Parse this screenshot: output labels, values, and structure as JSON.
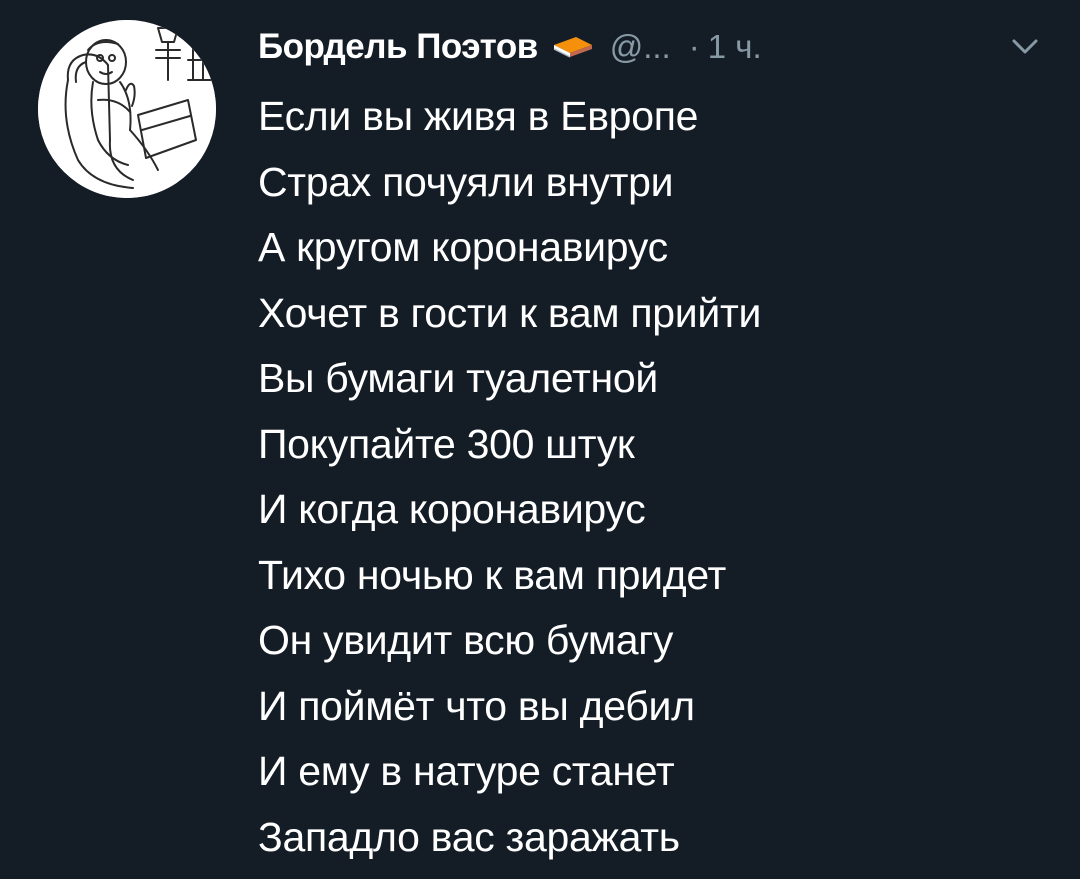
{
  "tweet": {
    "display_name": "Бордель Поэтов",
    "name_emoji_icon": "orange-book-icon",
    "handle": "@...",
    "separator": "·",
    "timestamp": "1 ч.",
    "menu_icon": "chevron-down-icon",
    "lines": [
      "Если вы живя в Европе",
      "Страх почуяли внутри",
      "А кругом коронавирус",
      "Хочет в гости к вам прийти",
      "Вы бумаги туалетной",
      "Покупайте 300 штук",
      "И когда коронавирус",
      "Тихо ночью к вам придет",
      "Он увидит всю бумагу",
      "И поймёт что вы дебил",
      "И ему в натуре станет",
      "Западло вас заражать"
    ]
  },
  "colors": {
    "background": "#141d26",
    "text": "#ffffff",
    "muted": "#8899a6",
    "emoji_orange": "#f4900c"
  }
}
